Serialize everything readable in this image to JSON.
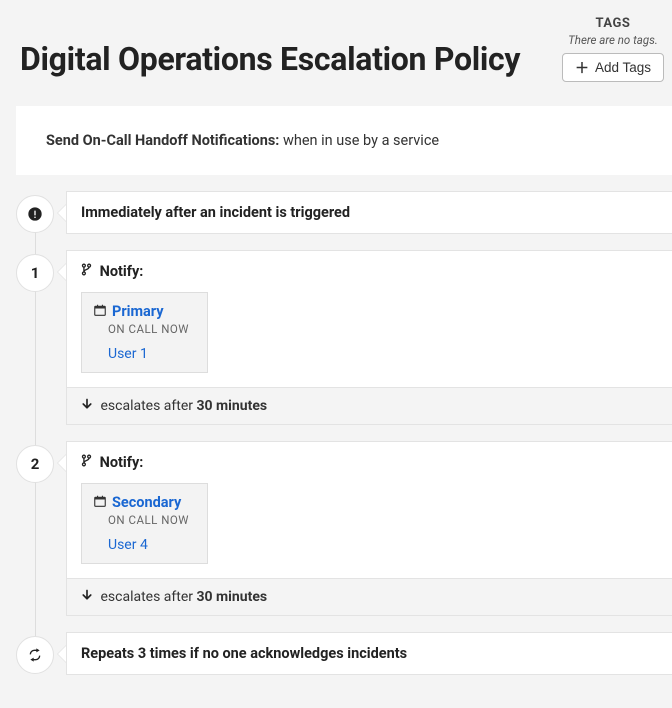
{
  "header": {
    "title": "Digital Operations Escalation Policy",
    "tags_label": "TAGS",
    "tags_empty": "There are no tags.",
    "add_tags_label": "Add Tags"
  },
  "handoff": {
    "label": "Send On-Call Handoff Notifications: ",
    "value": "when in use by a service"
  },
  "steps": {
    "immediate": {
      "text": "Immediately after an incident is triggered"
    },
    "level1": {
      "marker": "1",
      "notify_label": "Notify:",
      "schedule_name": "Primary",
      "schedule_status": "ON CALL NOW",
      "user": "User 1",
      "escalate_prefix": "escalates after ",
      "escalate_value": "30 minutes"
    },
    "level2": {
      "marker": "2",
      "notify_label": "Notify:",
      "schedule_name": "Secondary",
      "schedule_status": "ON CALL NOW",
      "user": "User 4",
      "escalate_prefix": "escalates after ",
      "escalate_value": "30 minutes"
    },
    "repeat": {
      "text": "Repeats 3 times if no one acknowledges incidents"
    }
  }
}
